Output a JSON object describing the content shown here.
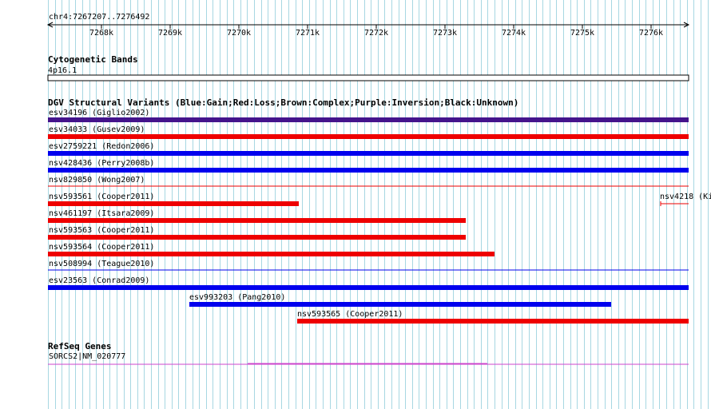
{
  "ruler": {
    "position": "chr4:7267207..7276492",
    "ticks": [
      "7268k",
      "7269k",
      "7270k",
      "7271k",
      "7272k",
      "7273k",
      "7274k",
      "7275k",
      "7276k"
    ]
  },
  "cytoband": {
    "title": "Cytogenetic Bands",
    "band": "4p16.1"
  },
  "dgv": {
    "title": "DGV Structural Variants (Blue:Gain;Red:Loss;Brown:Complex;Purple:Inversion;Black:Unknown)",
    "colors": {
      "gain": "#0000ee",
      "loss": "#ee0000",
      "inversion": "#44148c"
    },
    "variants": [
      {
        "label": "esv34196 (Giglio2002)",
        "type": "inversion",
        "start": "7267207+",
        "end": "7276492+"
      },
      {
        "label": "esv34033 (Gusev2009)",
        "type": "loss",
        "start": "7267207+",
        "end": "7276492+"
      },
      {
        "label": "esv2759221 (Redon2006)",
        "type": "gain",
        "start": "7267207+",
        "end": "7276492+"
      },
      {
        "label": "nsv428436 (Perry2008b)",
        "type": "gain",
        "start": "7267207+",
        "end": "7276492+"
      },
      {
        "label": "nsv829850 (Wong2007)",
        "type": "loss",
        "start": "7267207+",
        "end": "7276492+"
      },
      {
        "label": "nsv593561 (Cooper2011)",
        "type": "loss",
        "start": "7267207+",
        "end": "7270850"
      },
      {
        "label": "nsv4218 (Ki",
        "type": "loss",
        "start": "7276100",
        "end": "7276492+"
      },
      {
        "label": "nsv461197 (Itsara2009)",
        "type": "loss",
        "start": "7267207+",
        "end": "7273270"
      },
      {
        "label": "nsv593563 (Cooper2011)",
        "type": "loss",
        "start": "7267207+",
        "end": "7273270"
      },
      {
        "label": "nsv593564 (Cooper2011)",
        "type": "loss",
        "start": "7267207+",
        "end": "7273680"
      },
      {
        "label": "nsv508994 (Teague2010)",
        "type": "gain",
        "start": "7267207+",
        "end": "7276492+"
      },
      {
        "label": "esv23563 (Conrad2009)",
        "type": "gain",
        "start": "7267207+",
        "end": "7276492+"
      },
      {
        "label": "esv993203 (Pang2010)",
        "type": "gain",
        "start": "7269270",
        "end": "7275400"
      },
      {
        "label": "nsv593565 (Cooper2011)",
        "type": "loss",
        "start": "7270840",
        "end": "7276492+"
      }
    ]
  },
  "refseq": {
    "title": "RefSeq Genes",
    "gene": "SORCS2|NM_020777",
    "color": "#cc44cc"
  },
  "grid_color": "#a7d7e2"
}
